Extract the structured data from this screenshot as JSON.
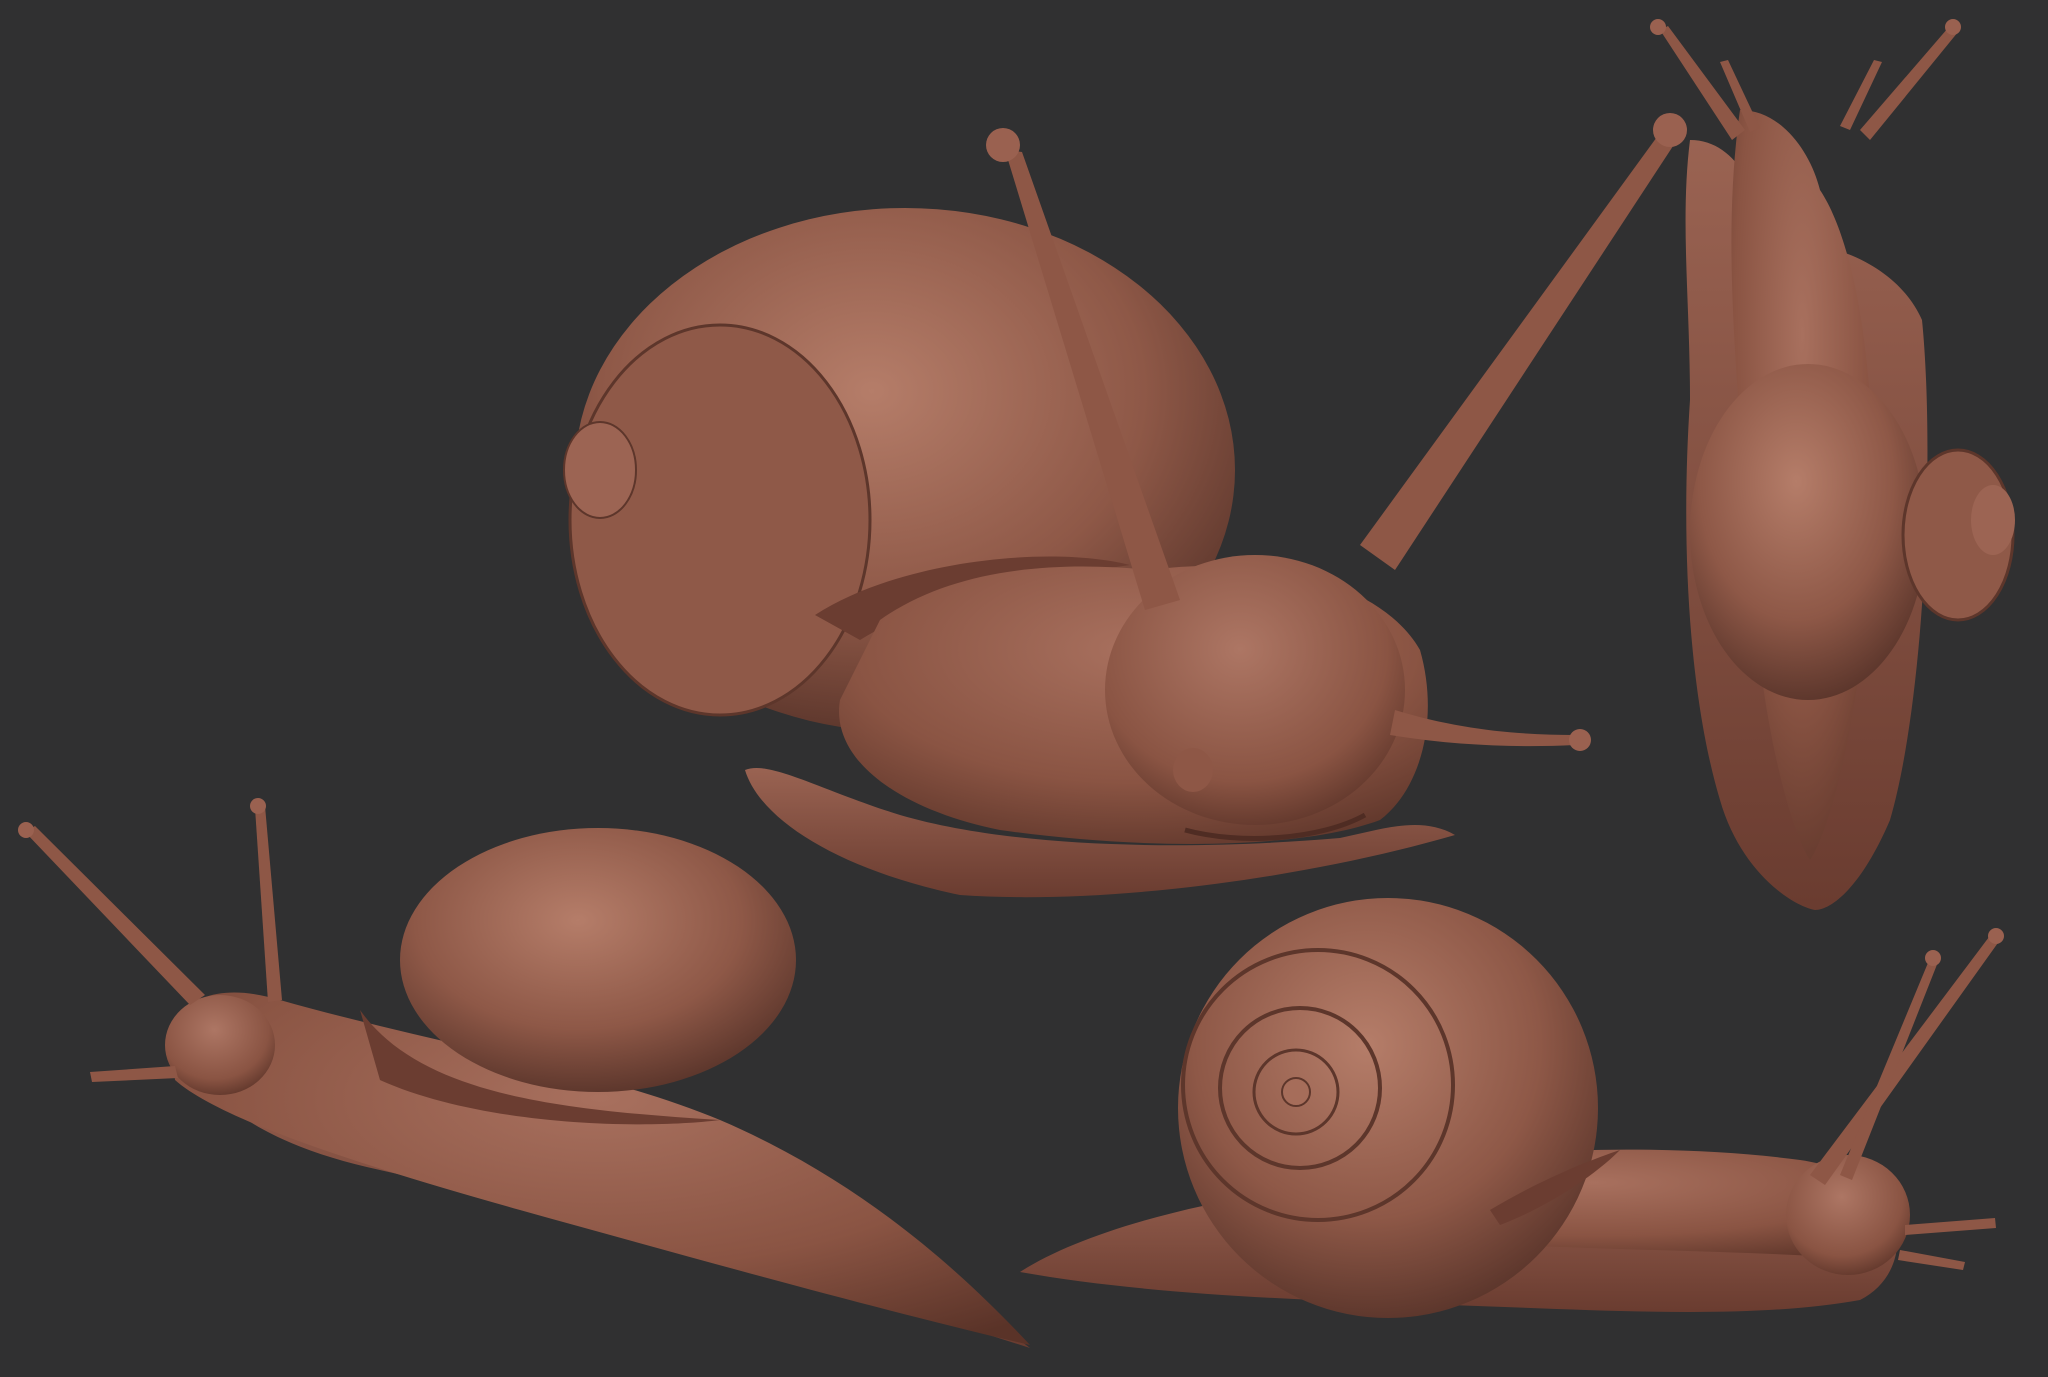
{
  "scene": {
    "background_color": "#303031",
    "subject": "clay-render-snail-model",
    "material_color": "#8a5443",
    "views": [
      {
        "name": "front-view",
        "shown": true
      },
      {
        "name": "top-view",
        "shown": true
      },
      {
        "name": "left-side-view",
        "shown": true
      },
      {
        "name": "right-side-view",
        "shown": true
      }
    ]
  }
}
